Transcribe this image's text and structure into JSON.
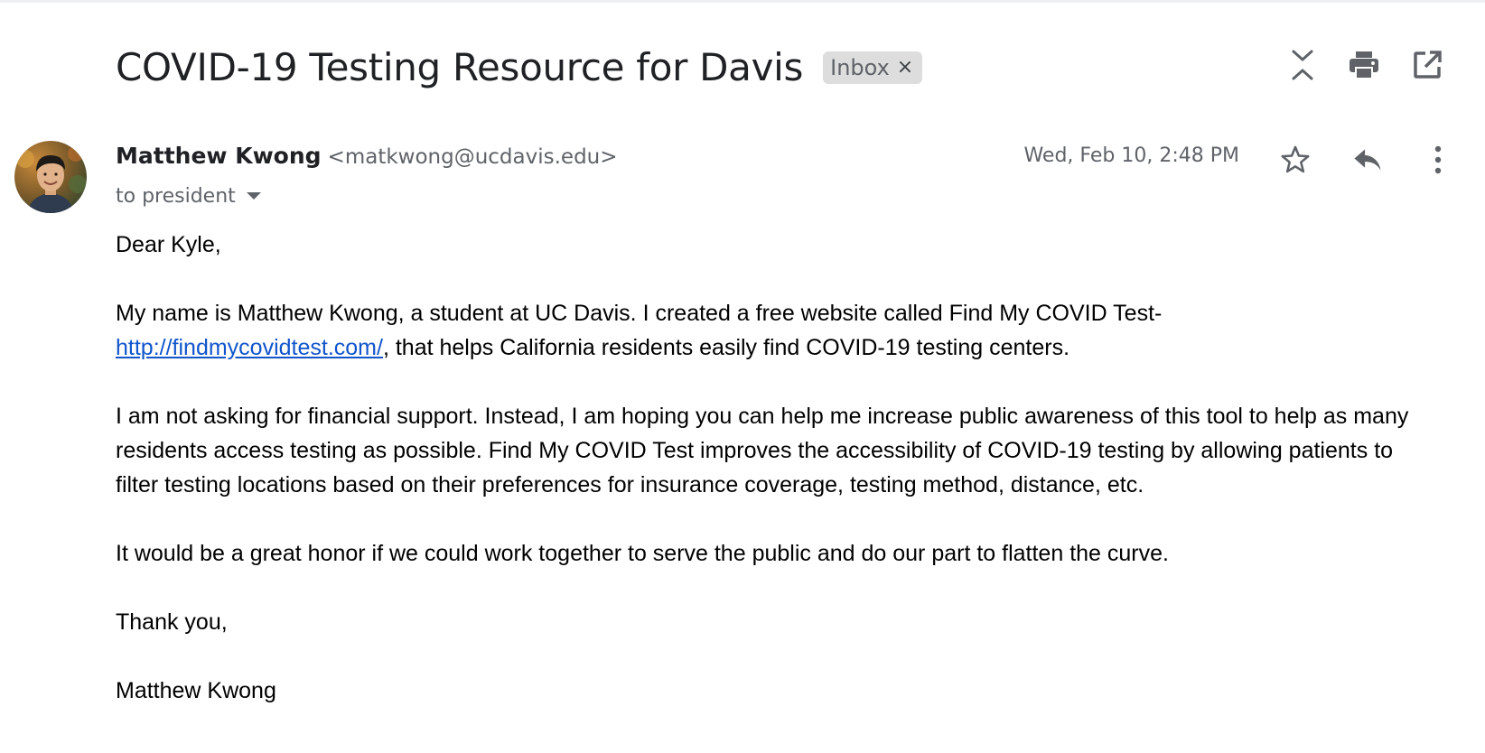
{
  "subject": "COVID-19 Testing Resource for Davis",
  "label_chip": {
    "label": "Inbox",
    "remove_glyph": "×"
  },
  "toolbar_icons": [
    "expand-collapse-icon",
    "print-icon",
    "open-in-new-window-icon"
  ],
  "message": {
    "sender_name": "Matthew Kwong",
    "sender_email": "<matkwong@ucdavis.edu>",
    "to_line": "to president",
    "date": "Wed, Feb 10, 2:48 PM",
    "action_icons": [
      "star-icon",
      "reply-icon",
      "more-options-icon"
    ],
    "body": {
      "greeting": "Dear Kyle,",
      "p1_before_link": "My name is Matthew Kwong, a student at UC Davis. I created a free website called Find My COVID Test-",
      "p1_link": "http://findmycovidtest.com/",
      "p1_after_link": ", that helps California residents easily find COVID-19 testing centers.",
      "p2": "I am not asking for financial support. Instead, I am hoping you can help me increase public awareness of this tool to help as many residents access testing as possible. Find My COVID Test improves the accessibility of COVID-19 testing by allowing patients to filter testing locations based on their preferences for insurance coverage, testing method, distance, etc.",
      "p3": "It would be a great honor if we could work together to serve the public and do our part to flatten the curve.",
      "closing": "Thank you,",
      "signature": "Matthew Kwong"
    }
  },
  "colors": {
    "link": "#1155cc",
    "chip_bg": "#dddddd",
    "secondary_text": "#5f6368",
    "icon": "#5f6368"
  }
}
